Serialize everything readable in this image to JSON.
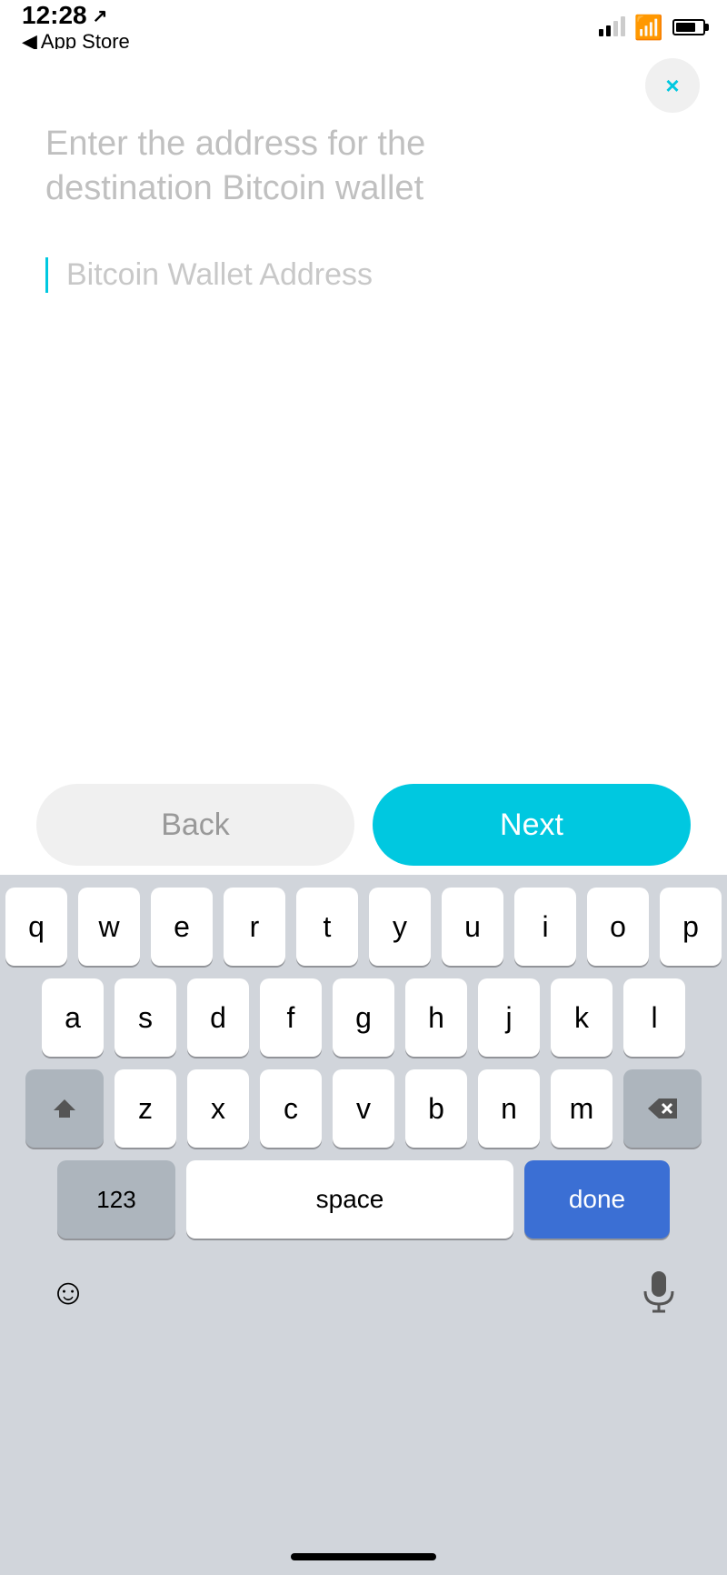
{
  "statusBar": {
    "time": "12:28",
    "appStoreBack": "App Store"
  },
  "header": {
    "closeLabel": "×"
  },
  "content": {
    "title": "Enter the address for the destination Bitcoin wallet",
    "inputPlaceholder": "Bitcoin Wallet Address"
  },
  "buttons": {
    "backLabel": "Back",
    "nextLabel": "Next"
  },
  "keyboard": {
    "row1": [
      "q",
      "w",
      "e",
      "r",
      "t",
      "y",
      "u",
      "i",
      "o",
      "p"
    ],
    "row2": [
      "a",
      "s",
      "d",
      "f",
      "g",
      "h",
      "j",
      "k",
      "l"
    ],
    "row3": [
      "z",
      "x",
      "c",
      "v",
      "b",
      "n",
      "m"
    ],
    "numbersLabel": "123",
    "spaceLabel": "space",
    "doneLabel": "done"
  },
  "colors": {
    "accent": "#00c8e0",
    "doneBlue": "#3b6fd4",
    "inputBorder": "#00c8e0"
  }
}
